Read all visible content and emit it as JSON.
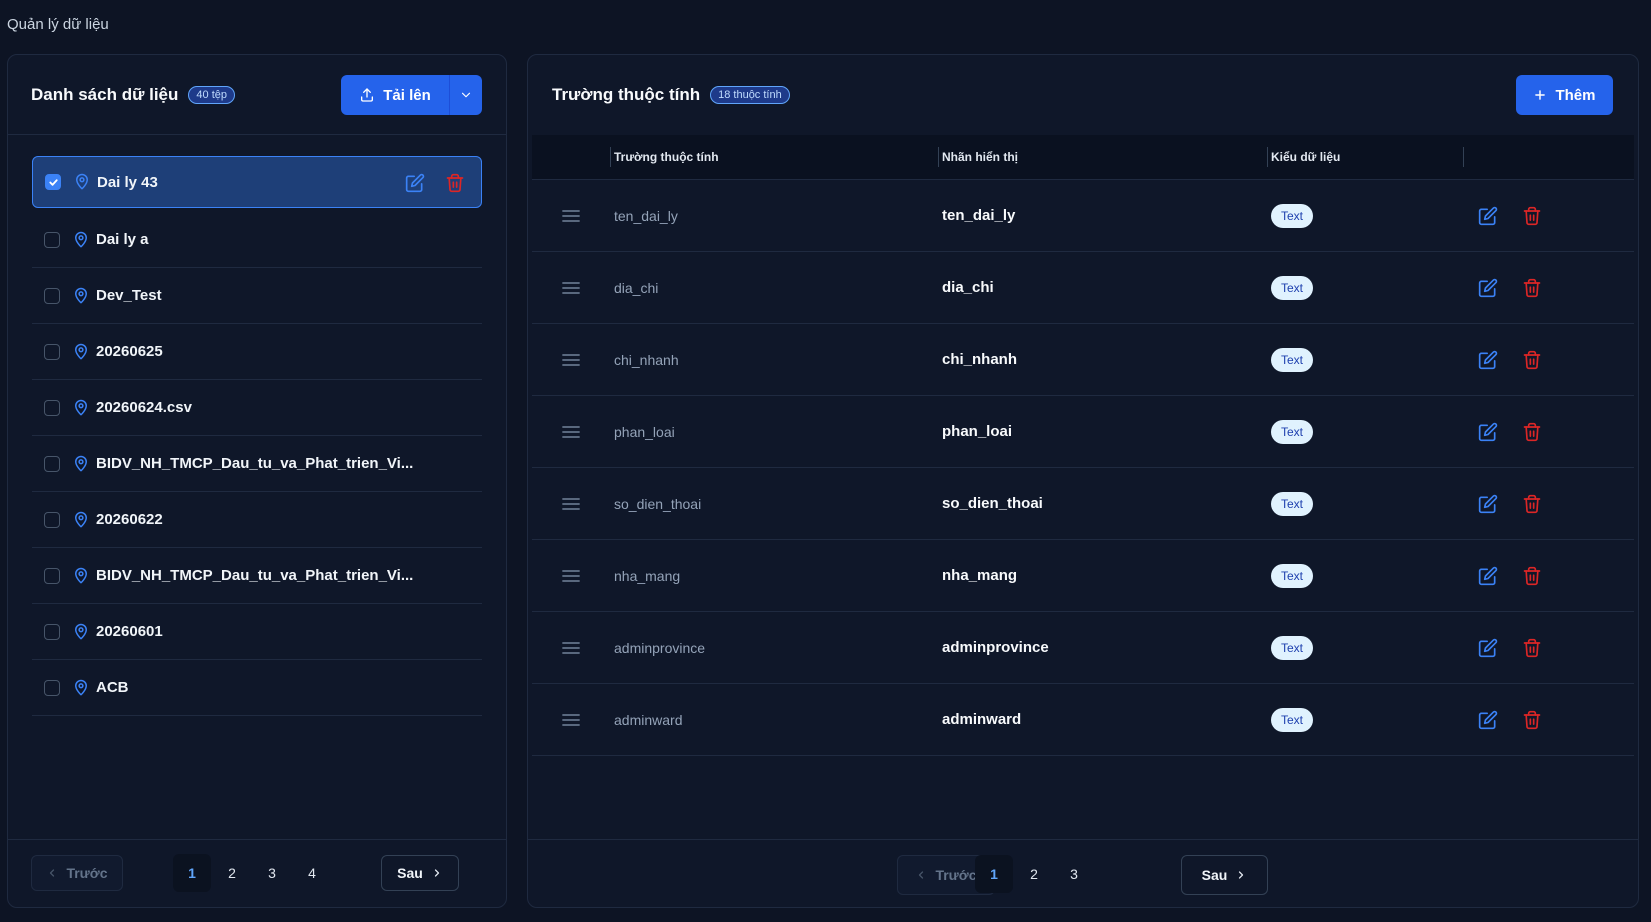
{
  "page": {
    "title": "Quản lý dữ liệu"
  },
  "left": {
    "title": "Danh sách dữ liệu",
    "count_badge": "40 tệp",
    "upload_label": "Tải lên",
    "files": [
      {
        "name": "Dai ly 43",
        "selected": true
      },
      {
        "name": "Dai ly a",
        "selected": false
      },
      {
        "name": "Dev_Test",
        "selected": false
      },
      {
        "name": "20260625",
        "selected": false
      },
      {
        "name": "20260624.csv",
        "selected": false
      },
      {
        "name": "BIDV_NH_TMCP_Dau_tu_va_Phat_trien_Vi...",
        "selected": false
      },
      {
        "name": "20260622",
        "selected": false
      },
      {
        "name": "BIDV_NH_TMCP_Dau_tu_va_Phat_trien_Vi...",
        "selected": false
      },
      {
        "name": "20260601",
        "selected": false
      },
      {
        "name": "ACB",
        "selected": false
      }
    ],
    "pagination": {
      "prev": "Trước",
      "next": "Sau",
      "pages": [
        "1",
        "2",
        "3",
        "4"
      ],
      "current": "1"
    }
  },
  "right": {
    "title": "Trường thuộc tính",
    "count_badge": "18 thuộc tính",
    "add_label": "Thêm",
    "columns": [
      "Trường thuộc tính",
      "Nhãn hiển thị",
      "Kiểu dữ liệu"
    ],
    "rows": [
      {
        "field": "ten_dai_ly",
        "label": "ten_dai_ly",
        "type": "Text"
      },
      {
        "field": "dia_chi",
        "label": "dia_chi",
        "type": "Text"
      },
      {
        "field": "chi_nhanh",
        "label": "chi_nhanh",
        "type": "Text"
      },
      {
        "field": "phan_loai",
        "label": "phan_loai",
        "type": "Text"
      },
      {
        "field": "so_dien_thoai",
        "label": "so_dien_thoai",
        "type": "Text"
      },
      {
        "field": "nha_mang",
        "label": "nha_mang",
        "type": "Text"
      },
      {
        "field": "adminprovince",
        "label": "adminprovince",
        "type": "Text"
      },
      {
        "field": "adminward",
        "label": "adminward",
        "type": "Text"
      }
    ],
    "pagination": {
      "prev": "Trước",
      "next": "Sau",
      "pages": [
        "1",
        "2",
        "3"
      ],
      "current": "1"
    }
  },
  "colors": {
    "accent": "#2563eb",
    "danger": "#dc2626",
    "background": "#0d1424"
  },
  "icons": [
    "upload-icon",
    "chevron-down-icon",
    "plus-icon",
    "map-pin-icon",
    "edit-icon",
    "trash-icon",
    "drag-handle-icon",
    "chevron-left-icon",
    "chevron-right-icon",
    "check-icon"
  ]
}
